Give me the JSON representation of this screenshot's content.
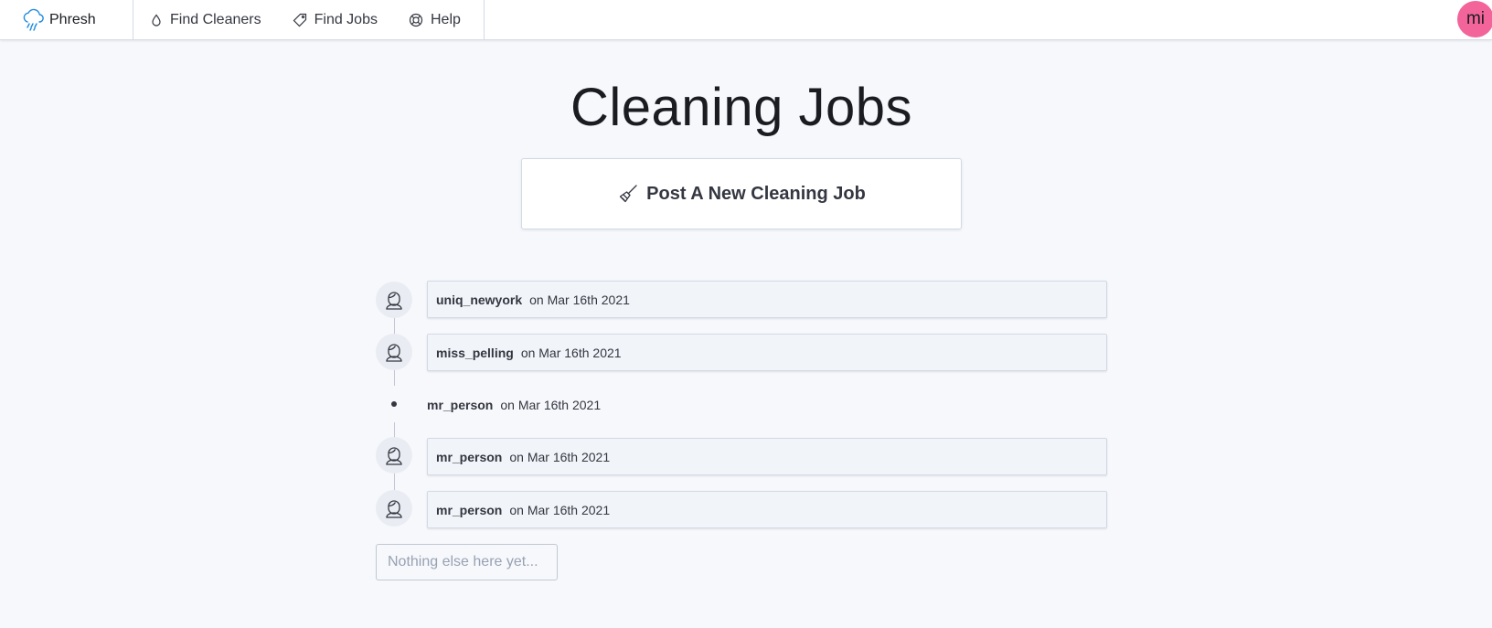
{
  "app": {
    "brand": "Phresh",
    "avatar_initials": "mi",
    "avatar_color": "#f2649a"
  },
  "nav": {
    "items": [
      {
        "label": "Find Cleaners",
        "icon": "droplet-icon"
      },
      {
        "label": "Find Jobs",
        "icon": "tag-icon"
      },
      {
        "label": "Help",
        "icon": "lifebuoy-icon"
      }
    ]
  },
  "page": {
    "title": "Cleaning Jobs",
    "post_button_label": "Post A New Cleaning Job",
    "post_button_icon": "broom-icon"
  },
  "timeline": {
    "items": [
      {
        "user": "uniq_newyork",
        "date": "on Mar 16th 2021",
        "style": "card"
      },
      {
        "user": "miss_pelling",
        "date": "on Mar 16th 2021",
        "style": "card"
      },
      {
        "user": "mr_person",
        "date": "on Mar 16th 2021",
        "style": "plain"
      },
      {
        "user": "mr_person",
        "date": "on Mar 16th 2021",
        "style": "card"
      },
      {
        "user": "mr_person",
        "date": "on Mar 16th 2021",
        "style": "card"
      }
    ],
    "empty_text": "Nothing else here yet..."
  }
}
